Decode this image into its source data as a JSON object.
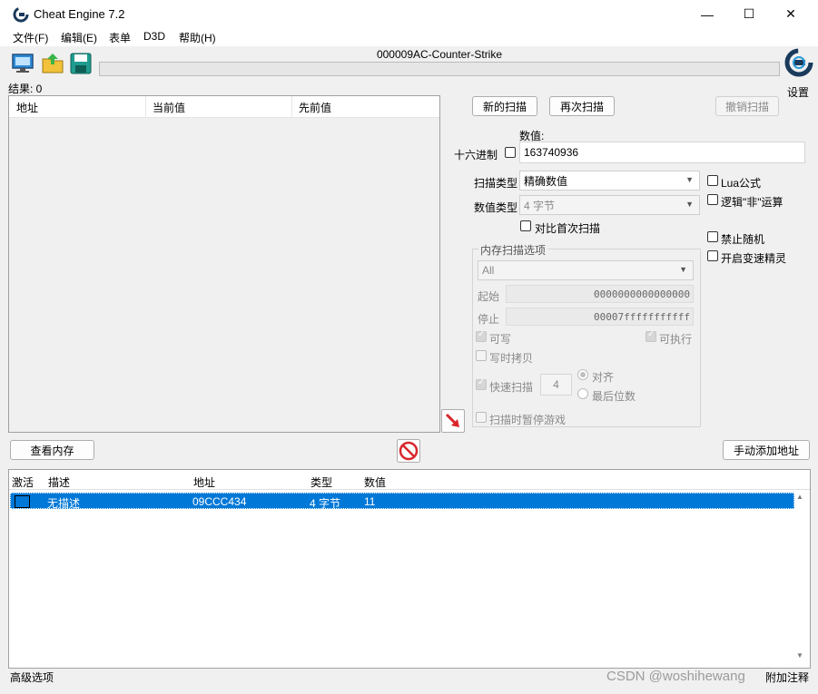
{
  "window": {
    "title": "Cheat Engine 7.2",
    "controls": {
      "minimize": "—",
      "maximize": "☐",
      "close": "✕"
    }
  },
  "menu": [
    "文件(F)",
    "编辑(E)",
    "表单",
    "D3D",
    "帮助(H)"
  ],
  "toolbar": {
    "process_name": "000009AC-Counter-Strike",
    "settings_label": "设置",
    "results_label": "结果: 0"
  },
  "results": {
    "columns": [
      "地址",
      "当前值",
      "先前值"
    ]
  },
  "scan": {
    "new_scan": "新的扫描",
    "next_scan": "再次扫描",
    "undo_scan": "撤销扫描",
    "value_label": "数值:",
    "hex_label": "十六进制",
    "value": "163740936",
    "scan_type_label": "扫描类型",
    "scan_type_value": "精确数值",
    "value_type_label": "数值类型",
    "value_type_value": "4 字节",
    "compare_first": "对比首次扫描",
    "lua_formula": "Lua公式",
    "logical_not": "逻辑\"非\"运算",
    "no_random": "禁止随机",
    "speedhack": "开启变速精灵"
  },
  "memory_options": {
    "title": "内存扫描选项",
    "region": "All",
    "start_label": "起始",
    "start_value": "0000000000000000",
    "stop_label": "停止",
    "stop_value": "00007fffffffffff",
    "writable": "可写",
    "executable": "可执行",
    "copy_on_write": "写时拷贝",
    "fast_scan": "快速扫描",
    "fast_scan_value": "4",
    "alignment": "对齐",
    "last_digits": "最后位数",
    "pause_game": "扫描时暂停游戏"
  },
  "actions": {
    "view_memory": "查看内存",
    "add_manual": "手动添加地址"
  },
  "address_list": {
    "columns": [
      "激活",
      "描述",
      "地址",
      "类型",
      "数值"
    ],
    "rows": [
      {
        "description": "无描述",
        "address": "09CCC434",
        "type": "4 字节",
        "value": "11"
      }
    ]
  },
  "status": {
    "advanced": "高级选项",
    "comments": "附加注释"
  },
  "watermark": "CSDN @woshihewang"
}
